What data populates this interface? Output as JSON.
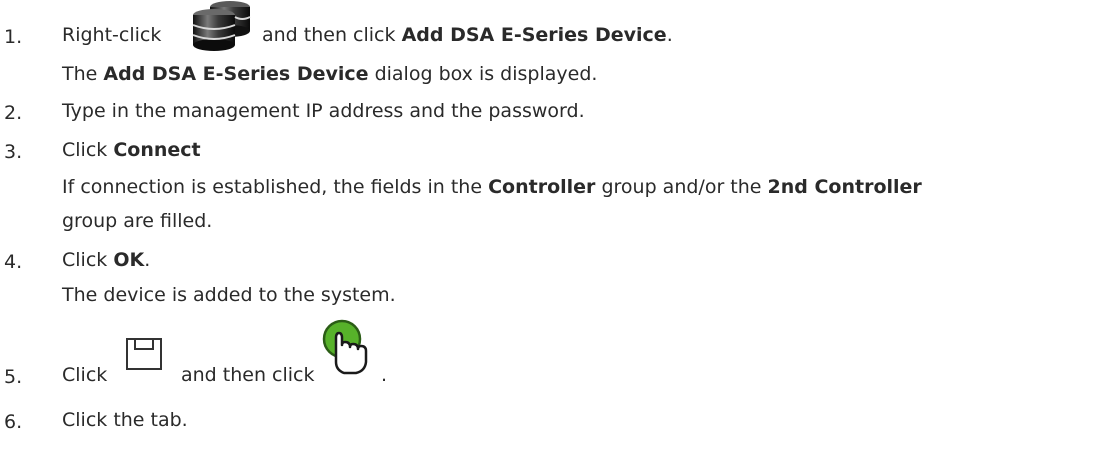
{
  "steps": [
    {
      "number": "1.",
      "line1": {
        "pre": "Right-click",
        "icon": "storage-device-icon",
        "mid": "and then click",
        "bold": "Add DSA E-Series Device",
        "post": "."
      },
      "line2": {
        "pre": "The",
        "bold": "Add DSA E-Series Device",
        "post": "dialog box is displayed."
      }
    },
    {
      "number": "2.",
      "text": "Type in the management IP address and the password."
    },
    {
      "number": "3.",
      "line1": {
        "pre": "Click",
        "bold": "Connect"
      },
      "line2": {
        "pre": "If connection is established, the fields in the",
        "bold1": "Controller",
        "mid": "group and/or the",
        "bold2": "2nd Controller"
      },
      "line3": "group are filled."
    },
    {
      "number": "4.",
      "line1": {
        "pre": "Click",
        "bold": "OK",
        "post": "."
      },
      "line2": "The device is added to the system."
    },
    {
      "number": "5.",
      "pre": "Click",
      "icon1": "save-icon",
      "mid": "and then click",
      "icon2": "activate-hand-icon",
      "post": "."
    },
    {
      "number": "6.",
      "text": "Click the tab."
    }
  ]
}
